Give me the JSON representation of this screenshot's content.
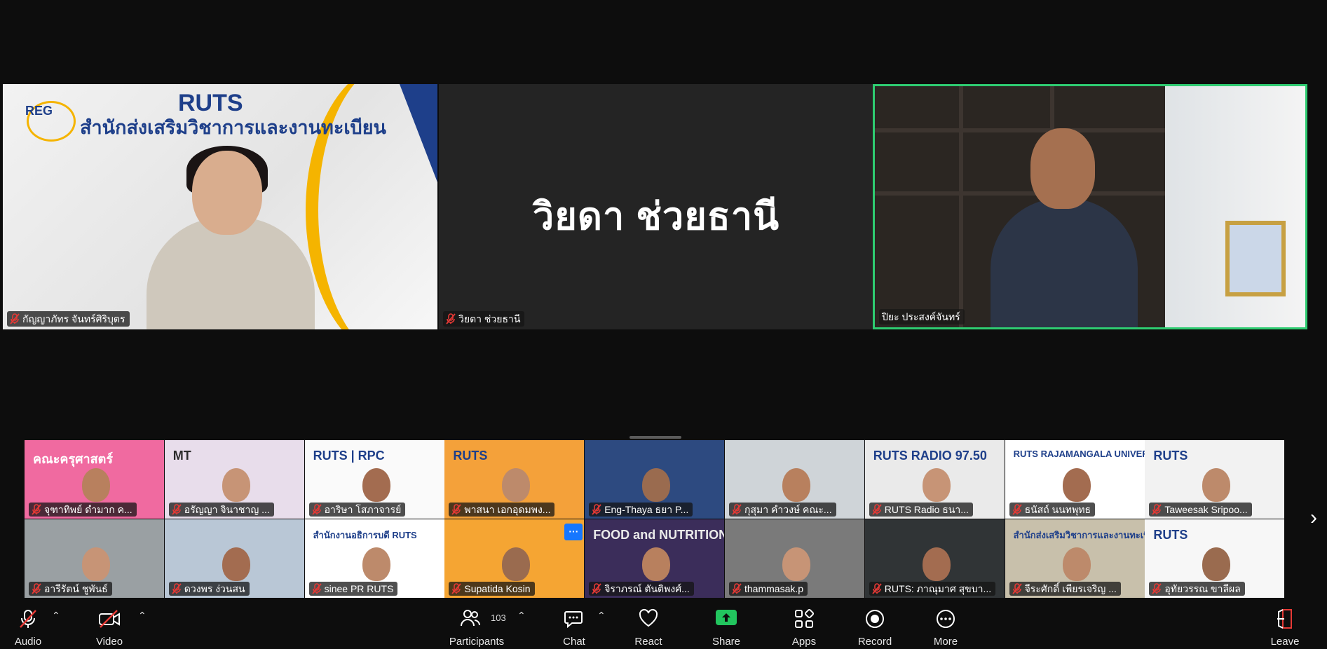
{
  "main_tiles": [
    {
      "name": "กัญญาภัทร จันทร์ศิริบุตร",
      "muted": true,
      "banner": {
        "logo": "RUTS",
        "title": "สำนักส่งเสริมวิชาการและงานทะเบียน",
        "badge": "REG"
      }
    },
    {
      "name": "วิยดา ช่วยธานี",
      "muted": true,
      "display_name": "วิยดา ช่วยธานี",
      "video_off": true
    },
    {
      "name": "ปิยะ ประสงค์จันทร์",
      "muted": false,
      "active_speaker": true
    }
  ],
  "gallery": {
    "row1": [
      {
        "name": "จุฑาทิพย์ ดำมาก ค...",
        "deco": "คณะครุศาสตร์"
      },
      {
        "name": "อรัญญา จินาชาญ ...",
        "deco": "MT"
      },
      {
        "name": "อาริษา โสภาจารย์",
        "deco": "RUTS | RPC"
      },
      {
        "name": "พาสนา เอกอุดมพง...",
        "deco": "RUTS"
      },
      {
        "name": "Eng-Thaya ธยา P...",
        "deco": ""
      },
      {
        "name": "กุสุมา คำวงษ์ คณะ...",
        "deco": ""
      },
      {
        "name": "RUTS Radio ธนา...",
        "deco": "RUTS RADIO 97.50"
      },
      {
        "name": "ธนัสถ์ นนทพุทธ",
        "deco": "RUTS RAJAMANGALA UNIVERSITY"
      },
      {
        "name": "Taweesak Sripoo...",
        "deco": "RUTS"
      }
    ],
    "row2": [
      {
        "name": "อารีรัตน์ ชูพันธ์",
        "deco": ""
      },
      {
        "name": "ดวงพร ง่วนสน",
        "deco": ""
      },
      {
        "name": "sinee PR RUTS",
        "deco": "สำนักงานอธิการบดี RUTS"
      },
      {
        "name": "Supatida Kosin",
        "deco": ""
      },
      {
        "name": "จิราภรณ์ ตันติพงศ์...",
        "deco": "FOOD and NUTRITION"
      },
      {
        "name": "thammasak.p",
        "deco": ""
      },
      {
        "name": "RUTS: ภาณุมาศ สุขบา...",
        "deco": ""
      },
      {
        "name": "จีระศักดิ์ เพียรเจริญ ...",
        "deco": "สำนักส่งเสริมวิชาการและงานทะเบียน"
      },
      {
        "name": "อุทัยวรรณ ขาลีผล",
        "deco": "RUTS"
      }
    ]
  },
  "toolbar": {
    "audio": "Audio",
    "video": "Video",
    "participants": "Participants",
    "participants_count": "103",
    "chat": "Chat",
    "react": "React",
    "share": "Share",
    "apps": "Apps",
    "record": "Record",
    "more": "More",
    "leave": "Leave"
  },
  "colors": {
    "background": "#0d0d0d",
    "active_speaker_border": "#2ecc71",
    "share_green": "#22c55e",
    "muted_red": "#e53935",
    "more_button": "#1677ff"
  }
}
